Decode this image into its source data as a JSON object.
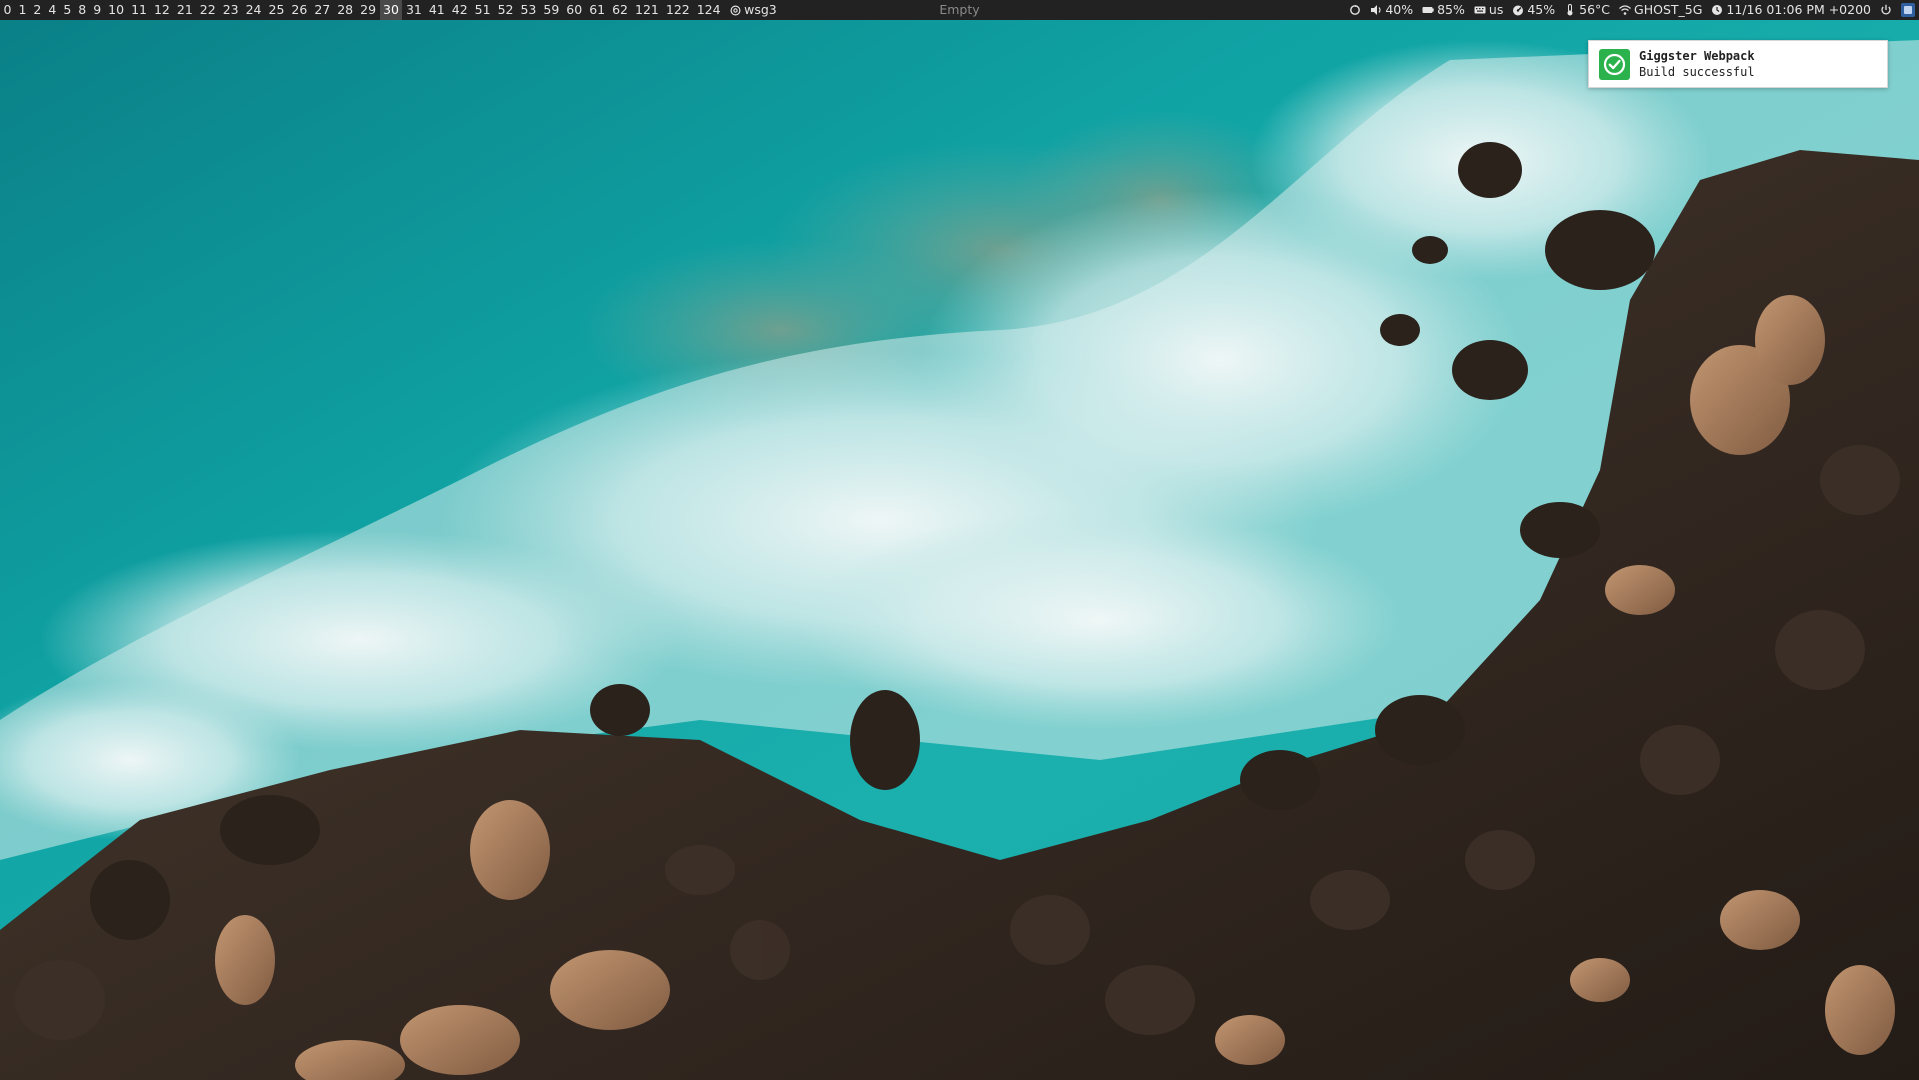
{
  "topbar": {
    "workspaces": [
      "0",
      "1",
      "2",
      "4",
      "5",
      "8",
      "9",
      "10",
      "11",
      "12",
      "21",
      "22",
      "23",
      "24",
      "25",
      "26",
      "27",
      "28",
      "29",
      "30",
      "31",
      "41",
      "42",
      "51",
      "52",
      "53",
      "59",
      "60",
      "61",
      "62",
      "121",
      "122",
      "124"
    ],
    "active_workspace": "30",
    "workspace_group": "wsg3",
    "window_title": "Empty",
    "status": {
      "volume": "40%",
      "battery": "85%",
      "keyboard_layout": "us",
      "cpu": "45%",
      "temperature": "56°C",
      "wifi": "GHOST_5G",
      "datetime": "11/16 01:06 PM +0200"
    },
    "colors": {
      "bar_background": "#222222",
      "bar_text": "#e4e4e4",
      "active_workspace_bg": "#4a4a4a",
      "title_text": "#8a8a8a"
    }
  },
  "notification": {
    "title": "Giggster Webpack",
    "body": "Build successful",
    "icon": "check-circle-icon",
    "icon_color": "#2bb24c"
  },
  "wallpaper": {
    "scene": "aerial-ocean-waves-rocks",
    "water_color": "#0f9ea0",
    "foam_color": "#e8f2f2",
    "rock_color": "#3a2e26"
  }
}
